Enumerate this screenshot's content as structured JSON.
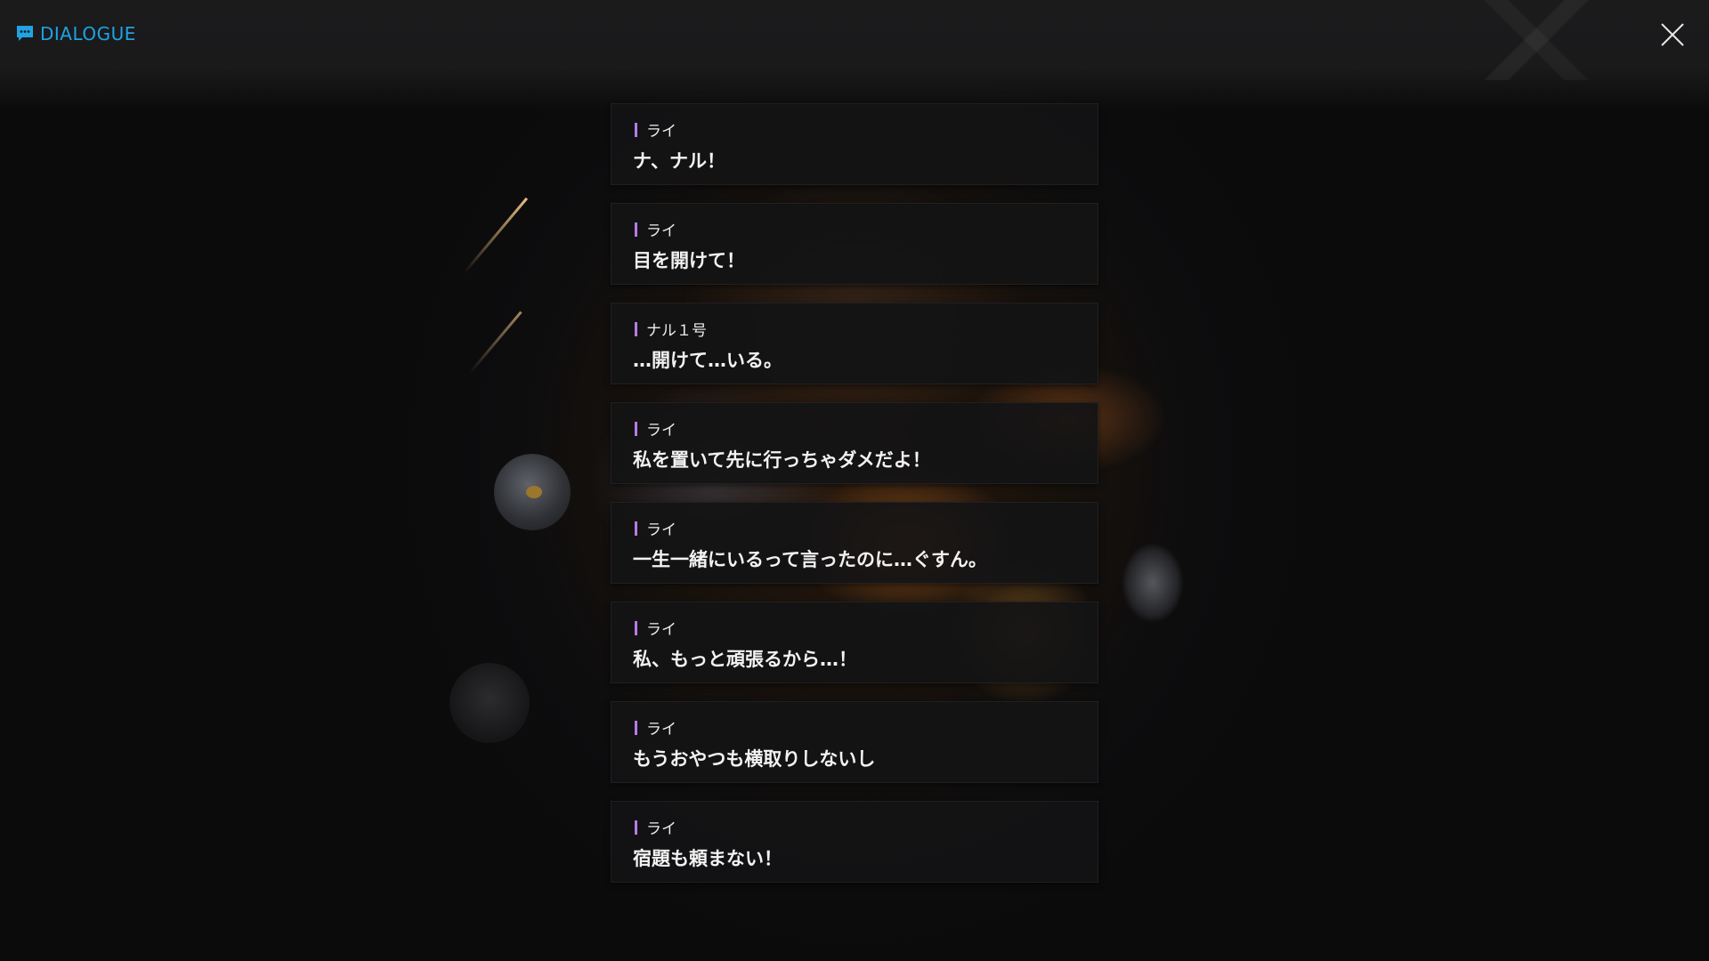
{
  "header": {
    "title": "DIALOGUE",
    "title_icon": "chat-bubble-icon",
    "close_icon": "close-icon",
    "accent_color": "#1fa3e3"
  },
  "speaker_bar_color": "#b67be6",
  "dialogue": [
    {
      "speaker": "ライ",
      "text": "ナ、ナル！"
    },
    {
      "speaker": "ライ",
      "text": "目を開けて！"
    },
    {
      "speaker": "ナル１号",
      "text": "…開けて…いる。"
    },
    {
      "speaker": "ライ",
      "text": "私を置いて先に行っちゃダメだよ！"
    },
    {
      "speaker": "ライ",
      "text": "一生一緒にいるって言ったのに…ぐすん。"
    },
    {
      "speaker": "ライ",
      "text": "私、もっと頑張るから…！"
    },
    {
      "speaker": "ライ",
      "text": "もうおやつも横取りしないし"
    },
    {
      "speaker": "ライ",
      "text": "宿題も頼まない！"
    }
  ]
}
